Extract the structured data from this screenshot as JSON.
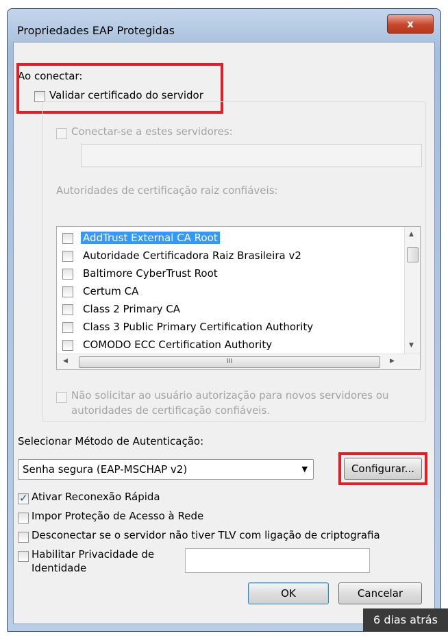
{
  "window": {
    "title": "Propriedades EAP Protegidas",
    "close_label": "x"
  },
  "connect": {
    "heading": "Ao conectar:",
    "validate_label": "Validar certificado do servidor",
    "servers_label": "Conectar-se a estes servidores:",
    "servers_value": "",
    "root_ca_label": "Autoridades de certificação raiz confiáveis:",
    "ca_list": [
      {
        "label": "AddTrust External CA Root",
        "selected": true
      },
      {
        "label": "Autoridade Certificadora Raiz Brasileira v2"
      },
      {
        "label": "Baltimore CyberTrust Root"
      },
      {
        "label": "Certum CA"
      },
      {
        "label": "Class 2 Primary CA"
      },
      {
        "label": "Class 3 Public Primary Certification Authority"
      },
      {
        "label": "COMODO ECC Certification Authority"
      }
    ],
    "hscroll_grip": "III",
    "no_prompt_label_1": "Não solicitar ao usuário autorização para novos servidores ou",
    "no_prompt_label_2": "autoridades de certificação confiáveis."
  },
  "auth": {
    "heading": "Selecionar Método de Autenticação:",
    "method_value": "Senha segura (EAP-MSCHAP v2)",
    "configure_label": "Configurar..."
  },
  "options": {
    "fast_reconnect": "Ativar Reconexão Rápida",
    "nap": "Impor Proteção de Acesso à Rede",
    "disconnect_tlv": "Desconectar se o servidor não tiver TLV com ligação de criptografia",
    "privacy_1": "Habilitar Privacidade de",
    "privacy_2": "Identidade",
    "privacy_value": ""
  },
  "buttons": {
    "ok": "OK",
    "cancel": "Cancelar"
  },
  "overlay": {
    "timestamp": "6 dias atrás"
  },
  "colors": {
    "highlight": "#e01f26",
    "selection": "#3399ff"
  }
}
